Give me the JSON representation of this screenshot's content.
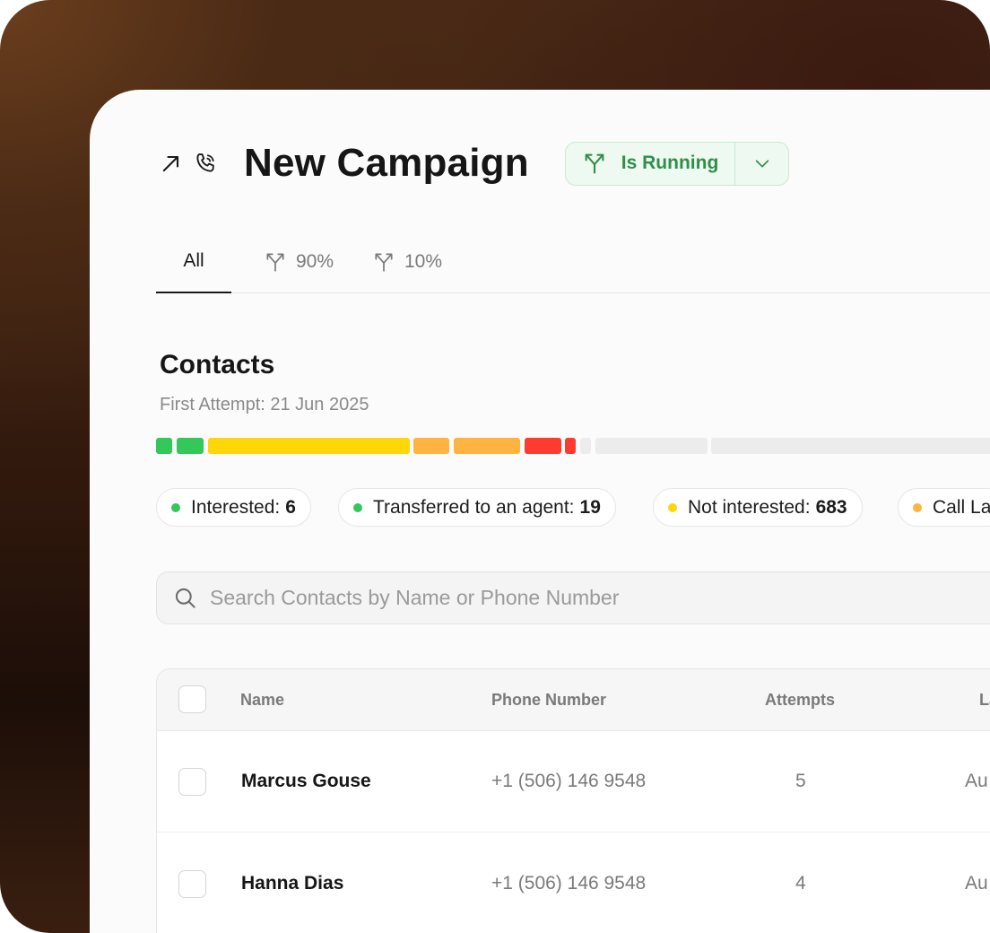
{
  "header": {
    "title": "New Campaign",
    "status_label": "Is Running"
  },
  "tabs": [
    {
      "label": "All",
      "active": true
    },
    {
      "label": "90%",
      "active": false
    },
    {
      "label": "10%",
      "active": false
    }
  ],
  "contacts": {
    "title": "Contacts",
    "first_attempt": "First Attempt: 21 Jun 2025",
    "pills": [
      {
        "label": "Interested:",
        "value": "6",
        "color": "#34c759"
      },
      {
        "label": "Transferred to an agent:",
        "value": "19",
        "color": "#34c759"
      },
      {
        "label": "Not interested:",
        "value": "683",
        "color": "#ffd60a"
      },
      {
        "label": "Call La",
        "value": "",
        "color": "#ffb340"
      }
    ]
  },
  "search": {
    "placeholder": "Search Contacts by Name or Phone Number"
  },
  "table": {
    "columns": [
      "Name",
      "Phone Number",
      "Attempts",
      "La"
    ],
    "rows": [
      {
        "name": "Marcus Gouse",
        "phone": "+1 (506) 146 9548",
        "attempts": "5",
        "last": "Au"
      },
      {
        "name": "Hanna Dias",
        "phone": "+1 (506) 146 9548",
        "attempts": "4",
        "last": "Au"
      }
    ]
  },
  "colors": {
    "green": "#34c759",
    "yellow": "#ffd60a",
    "orange": "#ffb340",
    "red": "#ff3b30",
    "gray": "#ececec"
  }
}
